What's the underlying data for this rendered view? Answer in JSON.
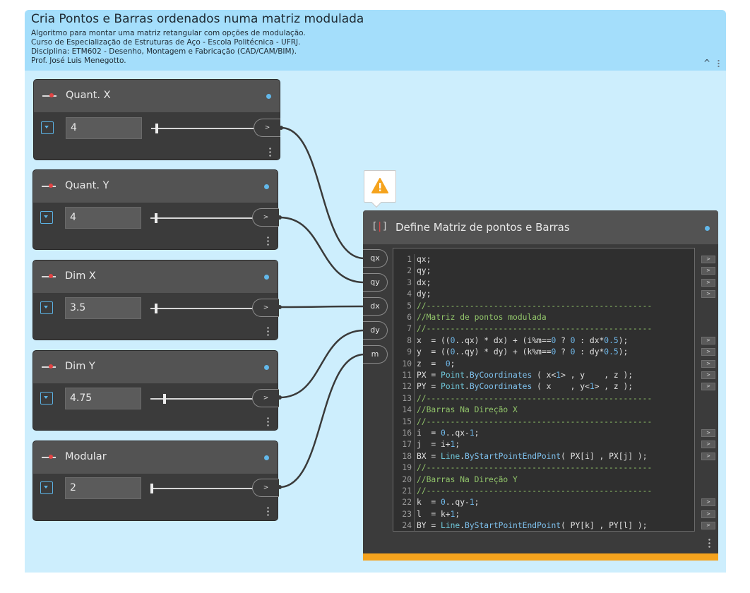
{
  "group": {
    "title": "Cria Pontos e Barras ordenados numa matriz modulada",
    "description": [
      "Algoritmo para montar uma matriz retangular com opções de modulação.",
      "Curso de Especialização de Estruturas de Aço - Escola Politécnica - UFRJ.",
      "Disciplina:  ETM602 - Desenho, Montagem e Fabricação (CAD/CAM/BIM).",
      "Prof. José Luis Menegotto."
    ],
    "collapse_icon": "chevron-up-icon",
    "accent_color": "#a4defb",
    "background_color": "#cdeefd"
  },
  "sliders": [
    {
      "title": "Quant. X",
      "value": "4",
      "output_port": ">",
      "level": 0.04
    },
    {
      "title": "Quant. Y",
      "value": "4",
      "output_port": ">",
      "level": 0.04
    },
    {
      "title": "Dim X",
      "value": "3.5",
      "output_port": ">",
      "level": 0.04
    },
    {
      "title": "Dim Y",
      "value": "4.75",
      "output_port": ">",
      "level": 0.12
    },
    {
      "title": "Modular",
      "value": "2",
      "output_port": ">",
      "level": 0.0
    }
  ],
  "code_block": {
    "title": "Define Matriz de pontos e Barras",
    "icon": "code-block-icon",
    "warning_icon": "warning-icon",
    "warning_color": "#f5a31d",
    "inputs": [
      "qx",
      "qy",
      "dx",
      "dy",
      "m"
    ],
    "output_port_label": ">",
    "output_lines": [
      1,
      2,
      3,
      4,
      8,
      9,
      10,
      11,
      12,
      16,
      17,
      18,
      22,
      23,
      24
    ],
    "lines": [
      [
        [
          "id",
          "qx;"
        ]
      ],
      [
        [
          "id",
          "qy;"
        ]
      ],
      [
        [
          "id",
          "dx;"
        ]
      ],
      [
        [
          "id",
          "dy;"
        ]
      ],
      [
        [
          "cm",
          "//-----------------------------------------------"
        ]
      ],
      [
        [
          "cm",
          "//Matriz de pontos modulada"
        ]
      ],
      [
        [
          "cm",
          "//-----------------------------------------------"
        ]
      ],
      [
        [
          "id",
          "x  = (("
        ],
        [
          "num",
          "0"
        ],
        [
          "id",
          "..qx) * dx) + (i%m=="
        ],
        [
          "num",
          "0"
        ],
        [
          "id",
          " ? "
        ],
        [
          "num",
          "0"
        ],
        [
          "id",
          " : dx*"
        ],
        [
          "num",
          "0.5"
        ],
        [
          "id",
          ");"
        ]
      ],
      [
        [
          "id",
          "y  = (("
        ],
        [
          "num",
          "0"
        ],
        [
          "id",
          "..qy) * dy) + (k%m=="
        ],
        [
          "num",
          "0"
        ],
        [
          "id",
          " ? "
        ],
        [
          "num",
          "0"
        ],
        [
          "id",
          " : dy*"
        ],
        [
          "num",
          "0.5"
        ],
        [
          "id",
          ");"
        ]
      ],
      [
        [
          "id",
          "z  =  "
        ],
        [
          "num",
          "0"
        ],
        [
          "id",
          ";"
        ]
      ],
      [
        [
          "id",
          "PX = "
        ],
        [
          "cls",
          "Point"
        ],
        [
          "id",
          "."
        ],
        [
          "fn",
          "ByCoordinates"
        ],
        [
          "id",
          " ( x<"
        ],
        [
          "num",
          "1"
        ],
        [
          "id",
          "> , y    , z );"
        ]
      ],
      [
        [
          "id",
          "PY = "
        ],
        [
          "cls",
          "Point"
        ],
        [
          "id",
          "."
        ],
        [
          "fn",
          "ByCoordinates"
        ],
        [
          "id",
          " ( x    , y<"
        ],
        [
          "num",
          "1"
        ],
        [
          "id",
          "> , z );"
        ]
      ],
      [
        [
          "cm",
          "//-----------------------------------------------"
        ]
      ],
      [
        [
          "cm",
          "//Barras Na Direção X"
        ]
      ],
      [
        [
          "cm",
          "//-----------------------------------------------"
        ]
      ],
      [
        [
          "id",
          "i  = "
        ],
        [
          "num",
          "0"
        ],
        [
          "id",
          "..qx-"
        ],
        [
          "num",
          "1"
        ],
        [
          "id",
          ";"
        ]
      ],
      [
        [
          "id",
          "j  = i+"
        ],
        [
          "num",
          "1"
        ],
        [
          "id",
          ";"
        ]
      ],
      [
        [
          "id",
          "BX = "
        ],
        [
          "cls",
          "Line"
        ],
        [
          "id",
          "."
        ],
        [
          "fn",
          "ByStartPointEndPoint"
        ],
        [
          "id",
          "( PX[i] , PX[j] );"
        ]
      ],
      [
        [
          "cm",
          "//-----------------------------------------------"
        ]
      ],
      [
        [
          "cm",
          "//Barras Na Direção Y"
        ]
      ],
      [
        [
          "cm",
          "//-----------------------------------------------"
        ]
      ],
      [
        [
          "id",
          "k  = "
        ],
        [
          "num",
          "0"
        ],
        [
          "id",
          "..qy-"
        ],
        [
          "num",
          "1"
        ],
        [
          "id",
          ";"
        ]
      ],
      [
        [
          "id",
          "l  = k+"
        ],
        [
          "num",
          "1"
        ],
        [
          "id",
          ";"
        ]
      ],
      [
        [
          "id",
          "BY = "
        ],
        [
          "cls",
          "Line"
        ],
        [
          "id",
          "."
        ],
        [
          "fn",
          "ByStartPointEndPoint"
        ],
        [
          "id",
          "( PY[k] , PY[l] );"
        ]
      ]
    ]
  }
}
